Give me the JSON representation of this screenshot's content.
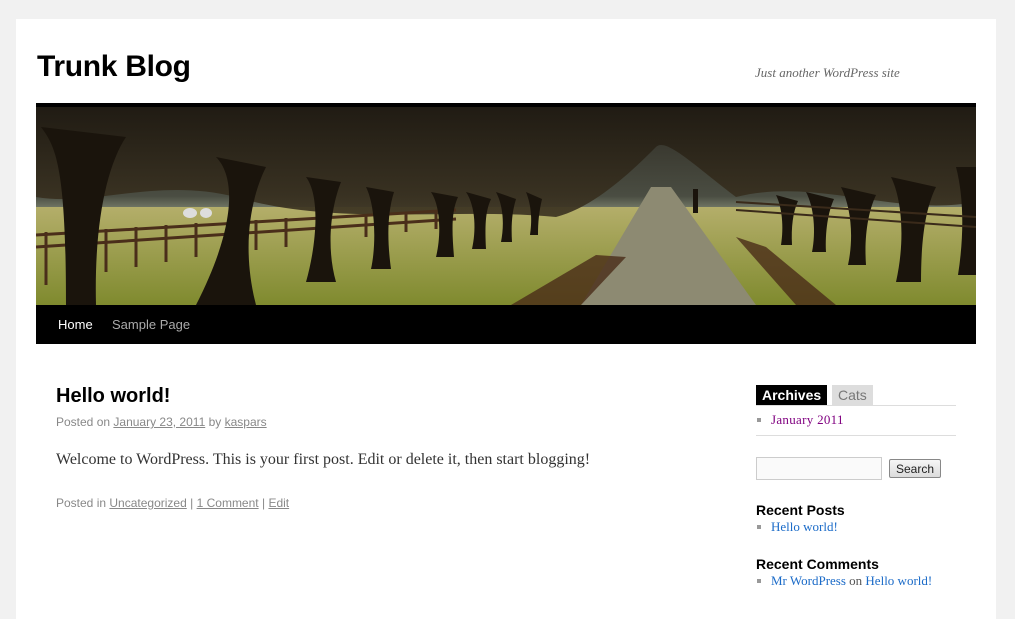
{
  "header": {
    "site_title": "Trunk Blog",
    "site_description": "Just another WordPress site",
    "header_image": "tree-lined-avenue-photo"
  },
  "nav": {
    "items": [
      {
        "label": "Home",
        "current": true
      },
      {
        "label": "Sample Page",
        "current": false
      }
    ]
  },
  "post": {
    "title": "Hello world!",
    "meta": {
      "posted_on_label": "Posted on",
      "date": "January 23, 2011",
      "by_label": "by",
      "author": "kaspars"
    },
    "content": "Welcome to WordPress. This is your first post. Edit or delete it, then start blogging!",
    "utility": {
      "posted_in_label": "Posted in",
      "category": "Uncategorized",
      "separator": "|",
      "comments": "1 Comment",
      "edit": "Edit"
    }
  },
  "sidebar": {
    "tabs": [
      {
        "label": "Archives",
        "active": true
      },
      {
        "label": "Cats",
        "active": false
      }
    ],
    "archives": [
      "January 2011"
    ],
    "search": {
      "value": "",
      "placeholder": "",
      "button_label": "Search"
    },
    "recent_posts": {
      "title": "Recent Posts",
      "items": [
        "Hello world!"
      ]
    },
    "recent_comments": {
      "title": "Recent Comments",
      "items": [
        {
          "author": "Mr WordPress",
          "on_label": "on",
          "post": "Hello world!"
        }
      ]
    }
  },
  "colors": {
    "page_bg": "#f1f1f1",
    "nav_bg": "#000000",
    "link_blue": "#1b6bc8",
    "visited_purple": "#800080",
    "meta_gray": "#888888"
  }
}
